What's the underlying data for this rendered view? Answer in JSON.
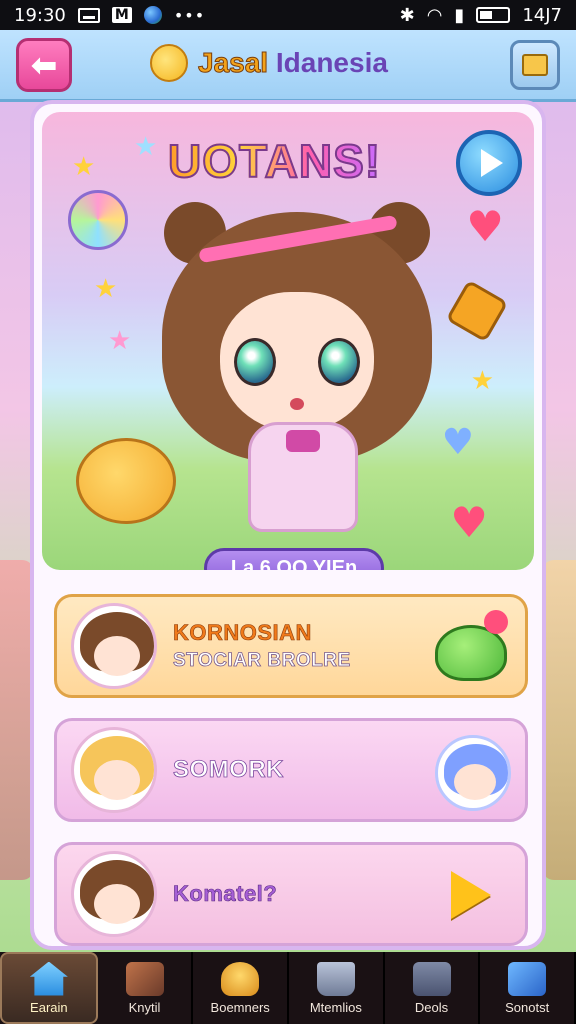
{
  "status_bar": {
    "time": "19:30",
    "battery": "14J7"
  },
  "header": {
    "title_part1": "Jasal",
    "title_part2": "Idanesia"
  },
  "hero": {
    "title": "UOTANS!",
    "pill_label": "La 6 OO YIEn"
  },
  "list": [
    {
      "title": "KORNOSIAN",
      "subtitle": "STOCIAR BROLRE"
    },
    {
      "title": "SOMORK",
      "subtitle": ""
    },
    {
      "title": "Komatel?",
      "subtitle": ""
    }
  ],
  "bottom_nav": [
    {
      "label": "Earain",
      "icon": "home-icon",
      "active": true
    },
    {
      "label": "Knytil",
      "icon": "tool-icon",
      "active": false
    },
    {
      "label": "Boemners",
      "icon": "shop-icon",
      "active": false
    },
    {
      "label": "Mtemlios",
      "icon": "cup-icon",
      "active": false
    },
    {
      "label": "Deols",
      "icon": "box-icon",
      "active": false
    },
    {
      "label": "Sonotst",
      "icon": "cube-icon",
      "active": false
    }
  ],
  "colors": {
    "accent_pink": "#e8489a",
    "header_blue": "#9fd0f5",
    "nav_bg": "#1a1114"
  }
}
